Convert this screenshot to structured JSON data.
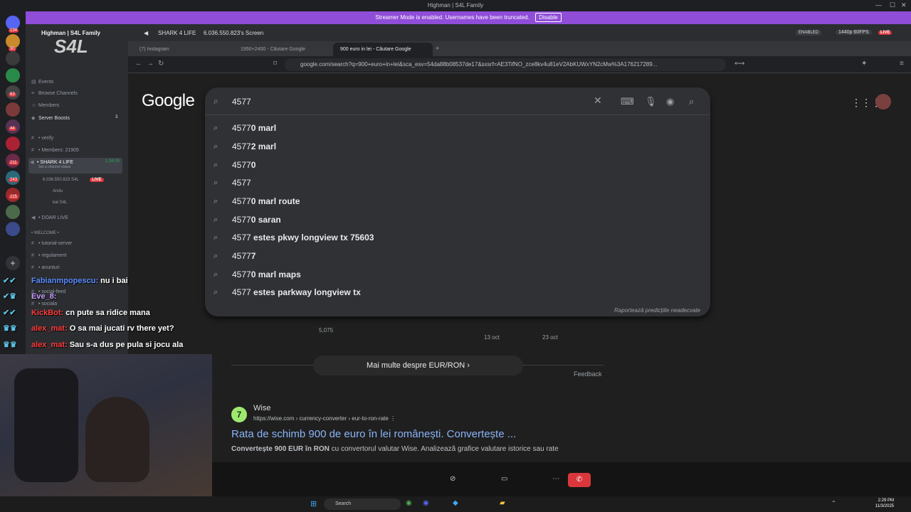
{
  "window": {
    "title": "Highman | S4L Family"
  },
  "streamer": {
    "text": "Streamer Mode is enabled. Usernames have been truncated.",
    "disable": "Disable"
  },
  "server": {
    "name": "Highman | S4L Family",
    "menu": [
      "Events",
      "Browse Channels",
      "Members",
      "Server Boosts"
    ],
    "boost_count": "3",
    "channels": [
      {
        "icon": "#",
        "label": "verify"
      },
      {
        "icon": "#",
        "label": "Members: 21905"
      },
      {
        "icon": "🔊",
        "label": "SHARK 4 LIFE",
        "time": "1:34:00",
        "status": "Set a channel status"
      },
      {
        "icon": "",
        "label": "6.036.550.823",
        "tag": "S4L",
        "live": "LIVE"
      },
      {
        "icon": "",
        "label": "Andu"
      },
      {
        "icon": "",
        "label": "kat",
        "tag": "S4L"
      },
      {
        "icon": "🔊",
        "label": "DOAR LIVE"
      },
      {
        "icon": "",
        "label": "WELCOME"
      },
      {
        "icon": "#",
        "label": "tutorial-server"
      },
      {
        "icon": "#",
        "label": "regulament"
      },
      {
        "icon": "#",
        "label": "anunturi"
      },
      {
        "icon": "#",
        "label": "social-feed"
      },
      {
        "icon": "#",
        "label": "sociala"
      }
    ]
  },
  "guild_badges": [
    "134",
    "30",
    "63",
    "44",
    "211",
    "243",
    "225"
  ],
  "voicebar": {
    "channel": "SHARK 4 LIFE",
    "streamer": "6.036.550.823's Screen",
    "enabled": "ENABLED",
    "quality": "1440p 60FPS",
    "live": "LIVE"
  },
  "browser": {
    "tabs": [
      "(7) Instagram",
      "1950+2400 - Căutare Google",
      "900 euro in lei - Căutare Google"
    ],
    "url": "google.com/search?q=900+euro+in+lei&sca_esv=54da88b08537de17&sxsrf=AE3TifNO_zce8kv4u81eV2AbKUWxYN2cMw%3A176217289..."
  },
  "google": {
    "logo": "Google",
    "query": "4577",
    "suggestions": [
      {
        "prefix": "4577",
        "suffix": "0 marl"
      },
      {
        "prefix": "4577",
        "suffix": "2 marl"
      },
      {
        "prefix": "4577",
        "suffix": "0"
      },
      {
        "prefix": "4577",
        "suffix": ""
      },
      {
        "prefix": "4577",
        "suffix": "0 marl route"
      },
      {
        "prefix": "4577",
        "suffix": "0 saran"
      },
      {
        "prefix": "4577",
        "suffix": " estes pkwy longview tx 75603"
      },
      {
        "prefix": "4577",
        "suffix": "7"
      },
      {
        "prefix": "4577",
        "suffix": "0 marl maps"
      },
      {
        "prefix": "4577",
        "suffix": " estes parkway longview tx"
      }
    ],
    "report": "Raportează predicțiile neadecvate",
    "chart_axis": {
      "y": "5,075",
      "x1": "13 oct",
      "x2": "23 oct"
    },
    "more": "Mai multe despre EUR/RON",
    "feedback": "Feedback",
    "result": {
      "icon": "7",
      "site": "Wise",
      "url": "https://wise.com › currency-converter › eur-to-ron-rate",
      "title": "Rata de schimb 900 de euro în lei românești. Convertește ...",
      "snippet_bold": "Convertește 900 EUR în RON",
      "snippet": " cu convertorul valutar Wise. Analizează grafice valutare istorice sau rate"
    }
  },
  "chat": [
    {
      "user": "Fabianmpopescu:",
      "msg": " nu i bai",
      "color": "#5b8cff"
    },
    {
      "user": "Eve_8:",
      "msg": "",
      "color": "#c9a0ff"
    },
    {
      "user": "KickBot:",
      "msg": " cn pute sa ridice mana",
      "color": "#ff3b3b"
    },
    {
      "user": "alex_mat:",
      "msg": " O sa mai jucati rv there yet?",
      "color": "#ff3b3b"
    },
    {
      "user": "alex_mat:",
      "msg": " Sau s-a dus pe pula si jocu ala",
      "color": "#ff3b3b"
    }
  ],
  "taskbar": {
    "search": "Search",
    "time": "2:29 PM",
    "date": "11/3/2025"
  }
}
